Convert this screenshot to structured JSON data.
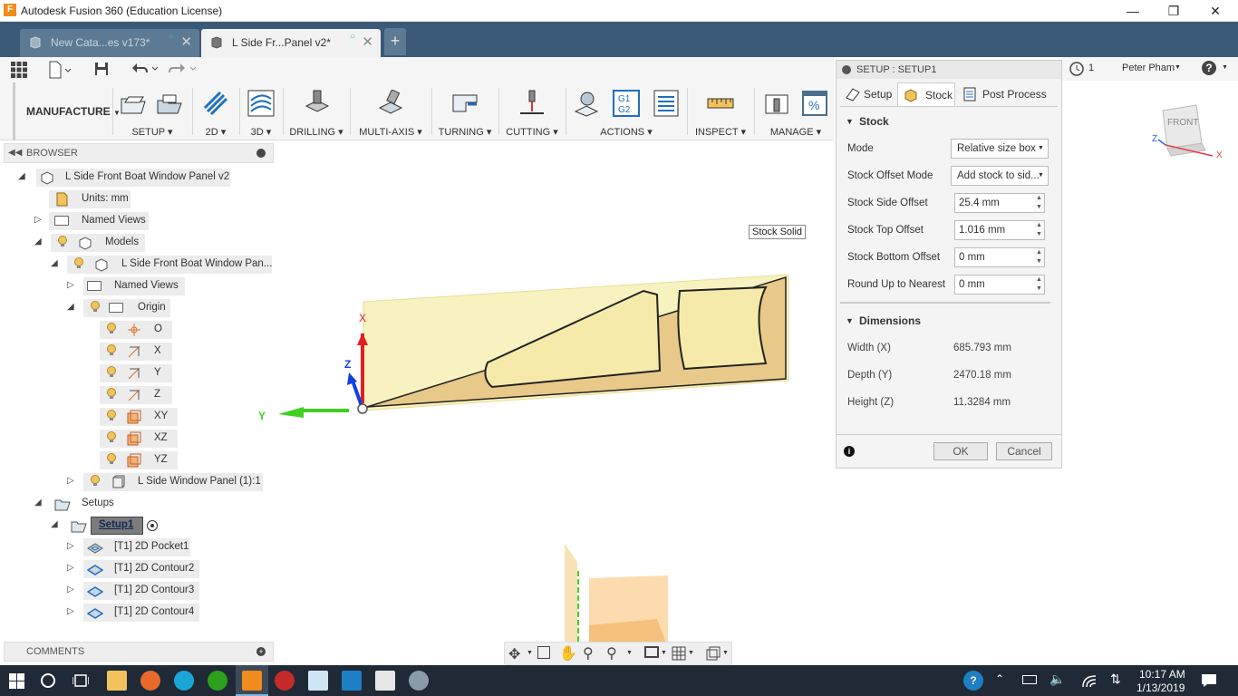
{
  "app": {
    "title": "Autodesk Fusion 360 (Education License)",
    "logo_letter": "F"
  },
  "tabs": [
    {
      "label": "New Cata...es v173*",
      "active": false
    },
    {
      "label": "L Side Fr...Panel v2*",
      "active": true
    }
  ],
  "ribbon": {
    "workspace": "MANUFACTURE",
    "groups": [
      "SETUP",
      "2D",
      "3D",
      "DRILLING",
      "MULTI-AXIS",
      "TURNING",
      "CUTTING",
      "ACTIONS",
      "INSPECT",
      "MANAGE"
    ]
  },
  "browser": {
    "title": "BROWSER",
    "items": [
      {
        "label": "L Side Front Boat Window Panel v2"
      },
      {
        "label": "Units: mm"
      },
      {
        "label": "Named Views"
      },
      {
        "label": "Models"
      },
      {
        "label": "L Side Front Boat Window Pan..."
      },
      {
        "label": "Named Views"
      },
      {
        "label": "Origin"
      },
      {
        "label": "O"
      },
      {
        "label": "X"
      },
      {
        "label": "Y"
      },
      {
        "label": "Z"
      },
      {
        "label": "XY"
      },
      {
        "label": "XZ"
      },
      {
        "label": "YZ"
      },
      {
        "label": "L Side Window Panel (1):1"
      },
      {
        "label": "Setups"
      },
      {
        "label": "Setup1"
      },
      {
        "label": "[T1] 2D Pocket1"
      },
      {
        "label": "[T1] 2D Contour2"
      },
      {
        "label": "[T1] 2D Contour3"
      },
      {
        "label": "[T1] 2D Contour4"
      }
    ]
  },
  "comments": {
    "title": "COMMENTS"
  },
  "viewport": {
    "tooltip": "Stock Solid",
    "axis_x": "X",
    "axis_y": "Y",
    "axis_z": "Z"
  },
  "viewcube": {
    "face": "FRONT",
    "axis_x": "X",
    "axis_z": "Z"
  },
  "dialog": {
    "title": "SETUP : SETUP1",
    "tabs": [
      "Setup",
      "Stock",
      "Post Process"
    ],
    "stock_section": "Stock",
    "fields": [
      {
        "label": "Mode",
        "value": "Relative size box"
      },
      {
        "label": "Stock Offset Mode",
        "value": "Add stock to sid..."
      },
      {
        "label": "Stock Side Offset",
        "value": "25.4 mm"
      },
      {
        "label": "Stock Top Offset",
        "value": "1.016 mm"
      },
      {
        "label": "Stock Bottom Offset",
        "value": "0 mm"
      },
      {
        "label": "Round Up to Nearest",
        "value": "0 mm"
      }
    ],
    "dimensions_section": "Dimensions",
    "dimensions": [
      {
        "label": "Width (X)",
        "value": "685.793 mm"
      },
      {
        "label": "Depth (Y)",
        "value": "2470.18 mm"
      },
      {
        "label": "Height (Z)",
        "value": "11.3284 mm"
      }
    ],
    "ok": "OK",
    "cancel": "Cancel"
  },
  "user": {
    "jobs_count": "1",
    "name": "Peter Pham"
  },
  "taskbar": {
    "time": "10:17 AM",
    "date": "1/13/2019"
  }
}
